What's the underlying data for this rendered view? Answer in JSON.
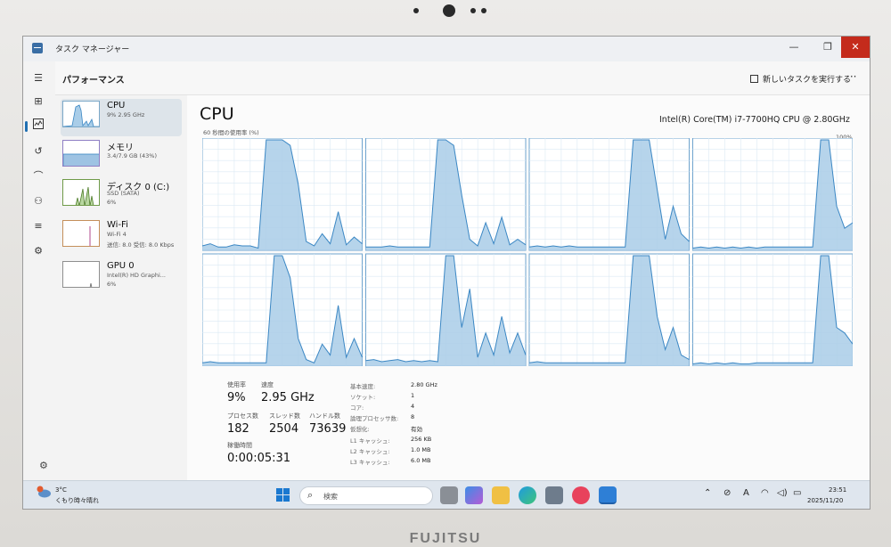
{
  "window": {
    "title": "タスク マネージャー",
    "minimize": "—",
    "maximize": "❐",
    "close": "✕"
  },
  "header": {
    "title": "パフォーマンス",
    "run_new_task": "新しいタスクを実行する",
    "more": "···"
  },
  "sidebar": {
    "devices": [
      {
        "name": "CPU",
        "sub1": "9% 2.95 GHz",
        "sub2": "",
        "sub3": ""
      },
      {
        "name": "メモリ",
        "sub1": "3.4/7.9 GB (43%)",
        "sub2": "",
        "sub3": ""
      },
      {
        "name": "ディスク 0 (C:)",
        "sub1": "SSD (SATA)",
        "sub2": "6%",
        "sub3": ""
      },
      {
        "name": "Wi-Fi",
        "sub1": "Wi-Fi 4",
        "sub2": "送信: 8.0 受信: 8.0 Kbps",
        "sub3": ""
      },
      {
        "name": "GPU 0",
        "sub1": "Intel(R) HD Graphi...",
        "sub2": "6%",
        "sub3": ""
      }
    ]
  },
  "main": {
    "title": "CPU",
    "model": "Intel(R) Core(TM) i7-7700HQ CPU @ 2.80GHz",
    "util_label": "60 秒間の使用率 (%)",
    "util_max": "100%",
    "stats": {
      "usage_label": "使用率",
      "usage_value": "9%",
      "speed_label": "速度",
      "speed_value": "2.95 GHz",
      "process_label": "プロセス数",
      "process_value": "182",
      "thread_label": "スレッド数",
      "thread_value": "2504",
      "handle_label": "ハンドル数",
      "handle_value": "73639",
      "uptime_label": "稼働時間",
      "uptime_value": "0:00:05:31"
    },
    "specs": [
      {
        "label": "基本速度:",
        "value": "2.80 GHz"
      },
      {
        "label": "ソケット:",
        "value": "1"
      },
      {
        "label": "コア:",
        "value": "4"
      },
      {
        "label": "論理プロセッサ数:",
        "value": "8"
      },
      {
        "label": "仮想化:",
        "value": "有効"
      },
      {
        "label": "L1 キャッシュ:",
        "value": "256 KB"
      },
      {
        "label": "L2 キャッシュ:",
        "value": "1.0 MB"
      },
      {
        "label": "L3 キャッシュ:",
        "value": "6.0 MB"
      }
    ]
  },
  "chart_data": {
    "type": "area",
    "title": "60 秒間の使用率 (%)",
    "ylim": [
      0,
      100
    ],
    "x": [
      0,
      3,
      6,
      9,
      12,
      15,
      18,
      21,
      24,
      27,
      30,
      33,
      36,
      39,
      42,
      45,
      48,
      51,
      54,
      57,
      60
    ],
    "series": [
      {
        "name": "",
        "values": [
          4,
          6,
          3,
          3,
          5,
          4,
          4,
          2,
          100,
          100,
          100,
          95,
          60,
          8,
          4,
          15,
          6,
          35,
          5,
          12,
          6
        ]
      },
      {
        "name": "",
        "values": [
          3,
          3,
          3,
          4,
          3,
          3,
          3,
          3,
          3,
          100,
          100,
          95,
          50,
          10,
          4,
          25,
          6,
          30,
          5,
          10,
          5
        ]
      },
      {
        "name": "",
        "values": [
          3,
          4,
          3,
          4,
          3,
          4,
          3,
          3,
          3,
          3,
          3,
          3,
          3,
          100,
          100,
          100,
          55,
          10,
          40,
          15,
          8
        ]
      },
      {
        "name": "",
        "values": [
          2,
          3,
          2,
          3,
          2,
          3,
          2,
          3,
          2,
          3,
          3,
          3,
          3,
          3,
          3,
          3,
          100,
          100,
          40,
          20,
          25
        ]
      },
      {
        "name": "",
        "values": [
          3,
          4,
          3,
          3,
          3,
          3,
          3,
          3,
          3,
          100,
          100,
          80,
          25,
          6,
          3,
          20,
          10,
          55,
          8,
          25,
          8
        ]
      },
      {
        "name": "",
        "values": [
          5,
          6,
          4,
          5,
          6,
          4,
          5,
          4,
          5,
          4,
          100,
          100,
          35,
          70,
          8,
          30,
          10,
          45,
          12,
          30,
          10
        ]
      },
      {
        "name": "",
        "values": [
          3,
          4,
          3,
          3,
          3,
          3,
          3,
          3,
          3,
          3,
          3,
          3,
          3,
          100,
          100,
          100,
          45,
          15,
          35,
          10,
          6
        ]
      },
      {
        "name": "",
        "values": [
          2,
          3,
          2,
          3,
          2,
          3,
          2,
          2,
          3,
          3,
          3,
          3,
          3,
          3,
          3,
          3,
          100,
          100,
          35,
          30,
          20
        ]
      }
    ]
  },
  "taskbar": {
    "weather_temp": "3°C",
    "weather_desc": "くもり時々晴れ",
    "search_placeholder": "検索",
    "clock_time": "23:51",
    "clock_date": "2025/11/20",
    "ime": "A"
  },
  "brand": "FUJITSU"
}
